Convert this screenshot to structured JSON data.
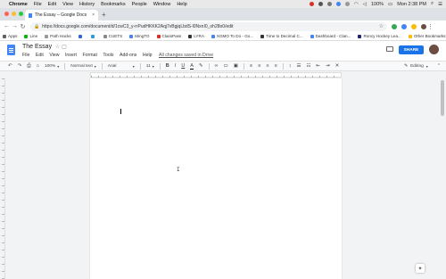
{
  "mac_menu": {
    "items": [
      "Chrome",
      "File",
      "Edit",
      "View",
      "History",
      "Bookmarks",
      "People",
      "Window",
      "Help"
    ],
    "battery": "100%",
    "clock": "Mon 2:38 PM"
  },
  "tab": {
    "title": "The Essay – Google Docs",
    "close": "×"
  },
  "newtab": "+",
  "nav": {
    "back": "←",
    "forward": "→",
    "reload": "↻",
    "url": "https://docs.google.com/document/d/1cwC3_y-rrPudHKKK2Aqj7vBgjqLbdS-l0NxnI0_oh28o0/edit",
    "star": "☆"
  },
  "bookmarks": {
    "items": [
      {
        "label": "Apps",
        "color": "#5f6368"
      },
      {
        "label": "Line",
        "color": "#00b900"
      },
      {
        "label": "Path Hacks",
        "color": "#999999"
      },
      {
        "label": "",
        "color": "#3367d6"
      },
      {
        "label": "",
        "color": "#2d9cdb"
      },
      {
        "label": "CUETS",
        "color": "#888888"
      },
      {
        "label": "MingTO",
        "color": "#4285f4"
      },
      {
        "label": "ClassPass",
        "color": "#d93025"
      },
      {
        "label": "LYRA",
        "color": "#333333"
      },
      {
        "label": "XGMO To Do - Go...",
        "color": "#4285f4"
      },
      {
        "label": "Time to Decimal C...",
        "color": "#333333"
      },
      {
        "label": "Dashboard - Clan...",
        "color": "#4285f4"
      },
      {
        "label": "Roncy Hockey Lea...",
        "color": "#1a237e"
      }
    ],
    "other": "Other Bookmarks"
  },
  "docs": {
    "title": "The Essay",
    "menus": [
      "File",
      "Edit",
      "View",
      "Insert",
      "Format",
      "Tools",
      "Add-ons",
      "Help"
    ],
    "saved_status": "All changes saved in Drive",
    "share_label": "SHARE"
  },
  "toolbar": {
    "undo": "↶",
    "redo": "↷",
    "print": "⎙",
    "paint": "🖌",
    "zoom": "100%",
    "style": "Normal text",
    "font": "Arial",
    "size": "11",
    "bold": "B",
    "italic": "I",
    "underline": "U",
    "textcolor": "A",
    "highlight": "✎",
    "link": "⛓",
    "comment": "▭",
    "image": "▣",
    "align_left": "≡",
    "align_center": "≡",
    "align_right": "≡",
    "justify": "≡",
    "line_spacing": "↕",
    "num_list": "⋮≡",
    "bullet_list": "•≡",
    "indent_less": "⇤",
    "indent_more": "⇥",
    "clear": "T̸",
    "mode": "Editing"
  },
  "page": {
    "text_cursor": "I"
  },
  "colors": {
    "share": "#1a73e8",
    "docs_blue": "#4285f4"
  }
}
